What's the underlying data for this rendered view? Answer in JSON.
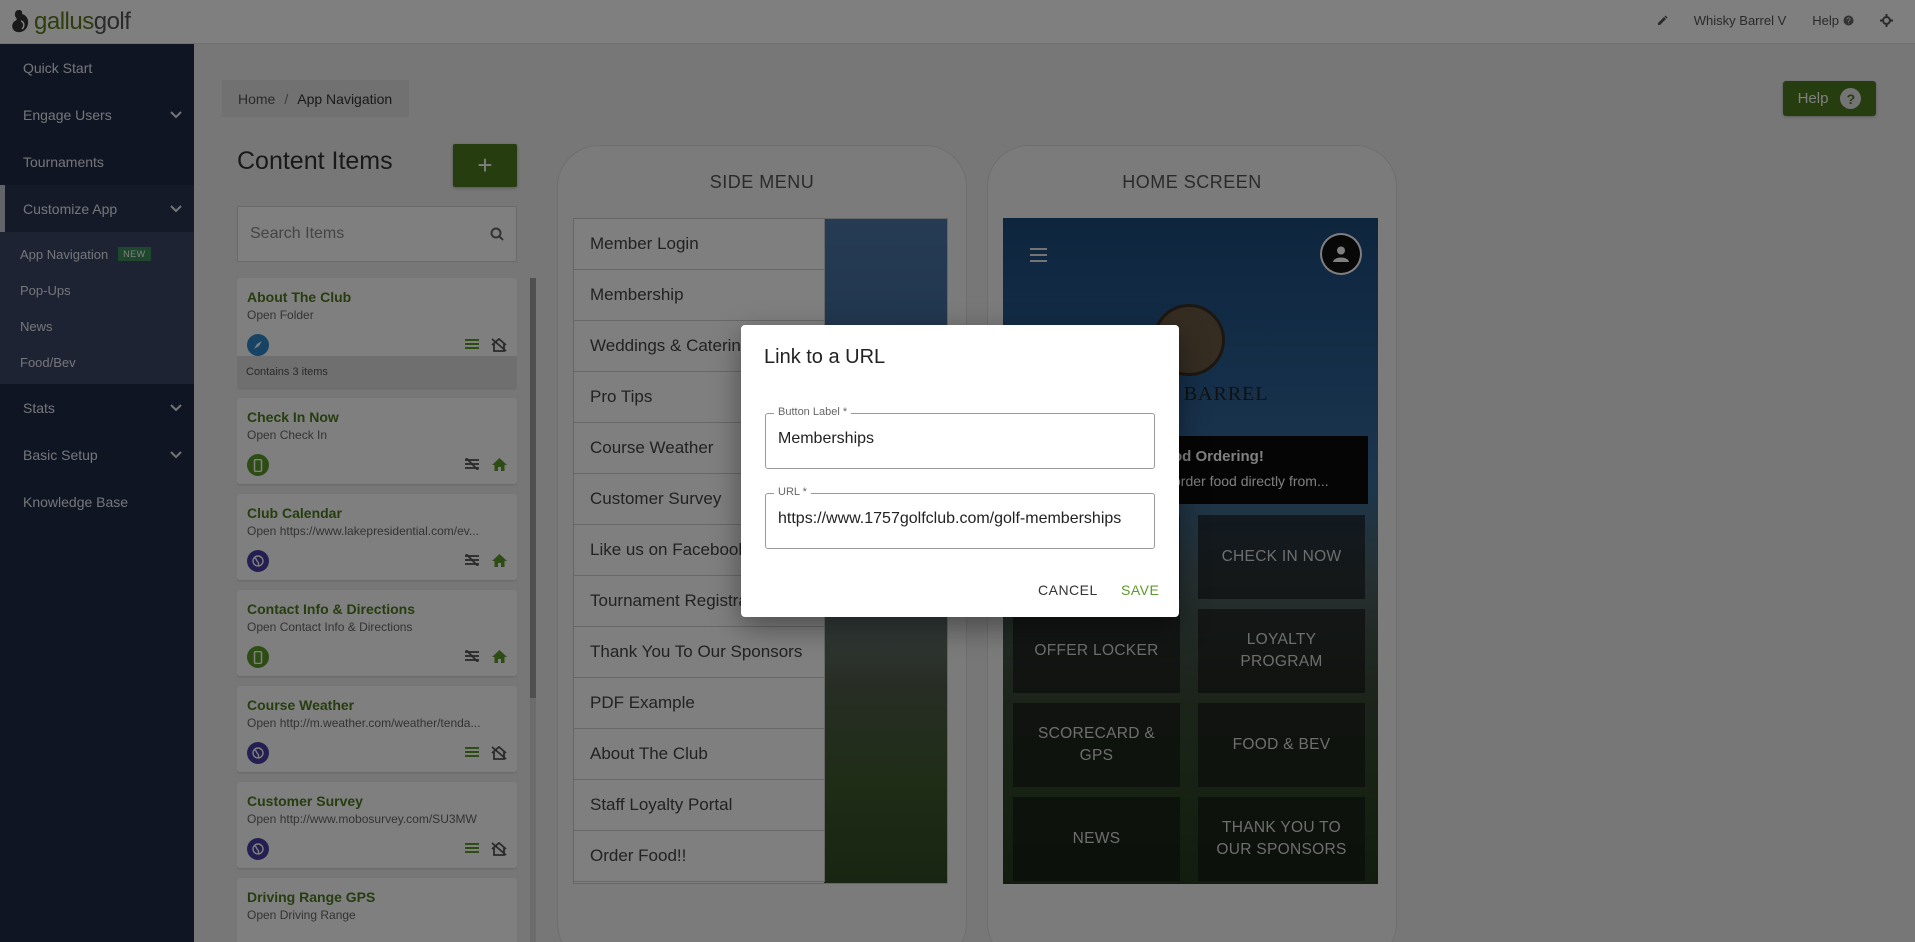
{
  "brand": {
    "name_part1": "gallus",
    "name_part2": "golf"
  },
  "topnav": {
    "edit_icon": "pencil-icon",
    "account": "Whisky Barrel V",
    "help": "Help",
    "help_icon": "question-circle-icon",
    "settings_icon": "gear-icon"
  },
  "sidebar": {
    "items": [
      {
        "label": "Quick Start"
      },
      {
        "label": "Engage Users"
      },
      {
        "label": "Tournaments"
      },
      {
        "label": "Customize App"
      },
      {
        "label": "Stats"
      },
      {
        "label": "Basic Setup"
      },
      {
        "label": "Knowledge Base"
      }
    ],
    "subitems": [
      {
        "label": "App Navigation",
        "badge": "NEW"
      },
      {
        "label": "Pop-Ups"
      },
      {
        "label": "News"
      },
      {
        "label": "Food/Bev"
      }
    ]
  },
  "breadcrumb": {
    "home": "Home",
    "separator": "/",
    "current": "App Navigation"
  },
  "help_button": {
    "label": "Help",
    "icon": "?"
  },
  "content_items": {
    "title": "Content Items",
    "add_label": "+",
    "search_placeholder": "Search Items",
    "cards": [
      {
        "title": "About The Club",
        "subtitle": "Open Folder",
        "footer": "Contains 3 items"
      },
      {
        "title": "Check In Now",
        "subtitle": "Open Check In"
      },
      {
        "title": "Club Calendar",
        "subtitle": "Open https://www.lakepresidential.com/ev..."
      },
      {
        "title": "Contact Info & Directions",
        "subtitle": "Open Contact Info & Directions"
      },
      {
        "title": "Course Weather",
        "subtitle": "Open http://m.weather.com/weather/tenda..."
      },
      {
        "title": "Customer Survey",
        "subtitle": "Open http://www.mobosurvey.com/SU3MW"
      },
      {
        "title": "Driving Range GPS",
        "subtitle": "Open Driving Range"
      }
    ]
  },
  "side_menu": {
    "title": "SIDE MENU",
    "items": [
      "Member Login",
      "Membership",
      "Weddings & Catering",
      "Pro Tips",
      "Course Weather",
      "Customer Survey",
      "Like us on Facebook",
      "Tournament Registration",
      "Thank You To Our Sponsors",
      "PDF Example",
      "About The Club",
      "Staff Loyalty Portal",
      "Order Food!!"
    ]
  },
  "home_screen": {
    "title": "HOME SCREEN",
    "brand": "Y BARREL",
    "banner_title": "od Ordering!",
    "banner_text": "order food directly from...",
    "tiles": [
      "",
      "CHECK IN NOW",
      "OFFER LOCKER",
      "LOYALTY PROGRAM",
      "SCORECARD & GPS",
      "FOOD & BEV",
      "NEWS",
      "THANK YOU TO OUR SPONSORS"
    ]
  },
  "modal": {
    "title": "Link to a URL",
    "label_field": {
      "label": "Button Label *",
      "value": "Memberships"
    },
    "url_field": {
      "label": "URL *",
      "value": "https://www.1757golfclub.com/golf-memberships"
    },
    "cancel": "CANCEL",
    "save": "SAVE"
  },
  "colors": {
    "accent": "#4d7a1e",
    "sidebar": "#212b46",
    "subnav": "#3c4668",
    "icon_blue": "#2f87c9",
    "icon_purple": "#4b3fa3",
    "icon_green": "#5c9a2a"
  }
}
